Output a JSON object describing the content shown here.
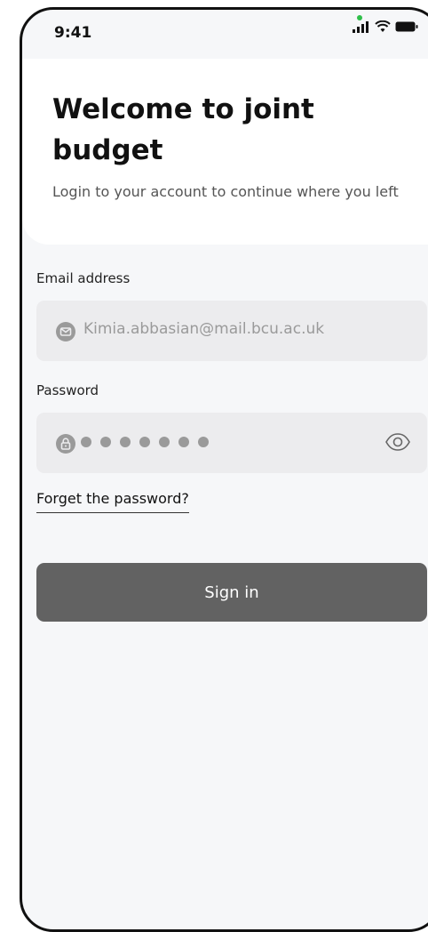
{
  "status_bar": {
    "time": "9:41"
  },
  "hero": {
    "title": "Welcome to joint budget",
    "subtitle": "Login to your account to continue where you left"
  },
  "form": {
    "email_label": "Email address",
    "email_value": "Kimia.abbasian@mail.bcu.ac.uk",
    "password_label": "Password",
    "forgot_link": "Forget the password?",
    "signin_button": "Sign in"
  },
  "colors": {
    "button_bg": "#626262",
    "field_bg": "#ececee",
    "page_bg": "#f6f7f9"
  }
}
